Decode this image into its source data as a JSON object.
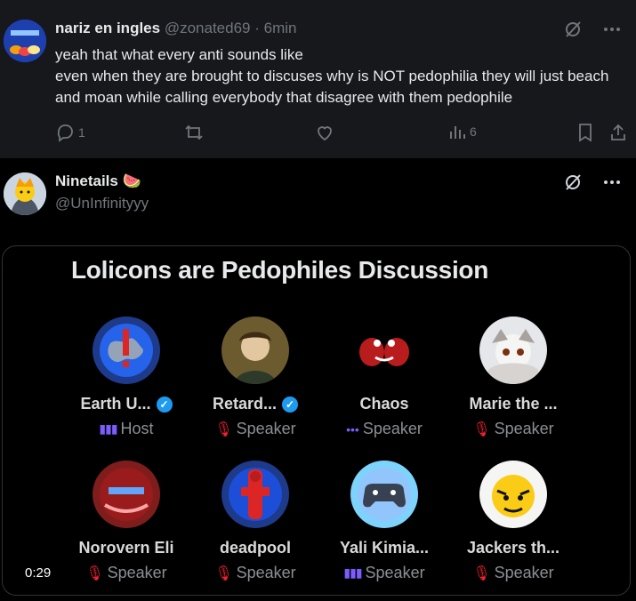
{
  "tweet1": {
    "name": "nariz en ingles",
    "handle": "@zonated69",
    "sep": "·",
    "time": "6min",
    "line1": "yeah that what every anti sounds like",
    "line2": "even when they are brought to discuses why is NOT pedophilia they will just beach and moan while calling everybody that disagree with them pedophile",
    "reply_count": "1",
    "views_count": "6"
  },
  "tweet2": {
    "name": "Ninetails",
    "emoji": "🍉",
    "handle": "@UnInfinityyy"
  },
  "space": {
    "title": "Lolicons are Pedophiles Discussion",
    "timer": "0:29",
    "participants": [
      {
        "name": "Earth U...",
        "role": "Host",
        "verified": true,
        "role_icon": "host"
      },
      {
        "name": "Retard...",
        "role": "Speaker",
        "verified": true,
        "role_icon": "mic-off"
      },
      {
        "name": "Chaos",
        "role": "Speaker",
        "verified": false,
        "role_icon": "dots"
      },
      {
        "name": "Marie the ...",
        "role": "Speaker",
        "verified": false,
        "role_icon": "mic-off"
      },
      {
        "name": "Norovern Eli",
        "role": "Speaker",
        "verified": false,
        "role_icon": "mic-off"
      },
      {
        "name": "deadpool",
        "role": "Speaker",
        "verified": false,
        "role_icon": "mic-off"
      },
      {
        "name": "Yali Kimia...",
        "role": "Speaker",
        "verified": false,
        "role_icon": "host"
      },
      {
        "name": "Jackers th...",
        "role": "Speaker",
        "verified": false,
        "role_icon": "mic-off"
      }
    ]
  },
  "colors": {
    "accent": "#1d9bf0",
    "muted": "#71767b",
    "mic_off": "#f4212e",
    "host": "#7c5cff"
  }
}
